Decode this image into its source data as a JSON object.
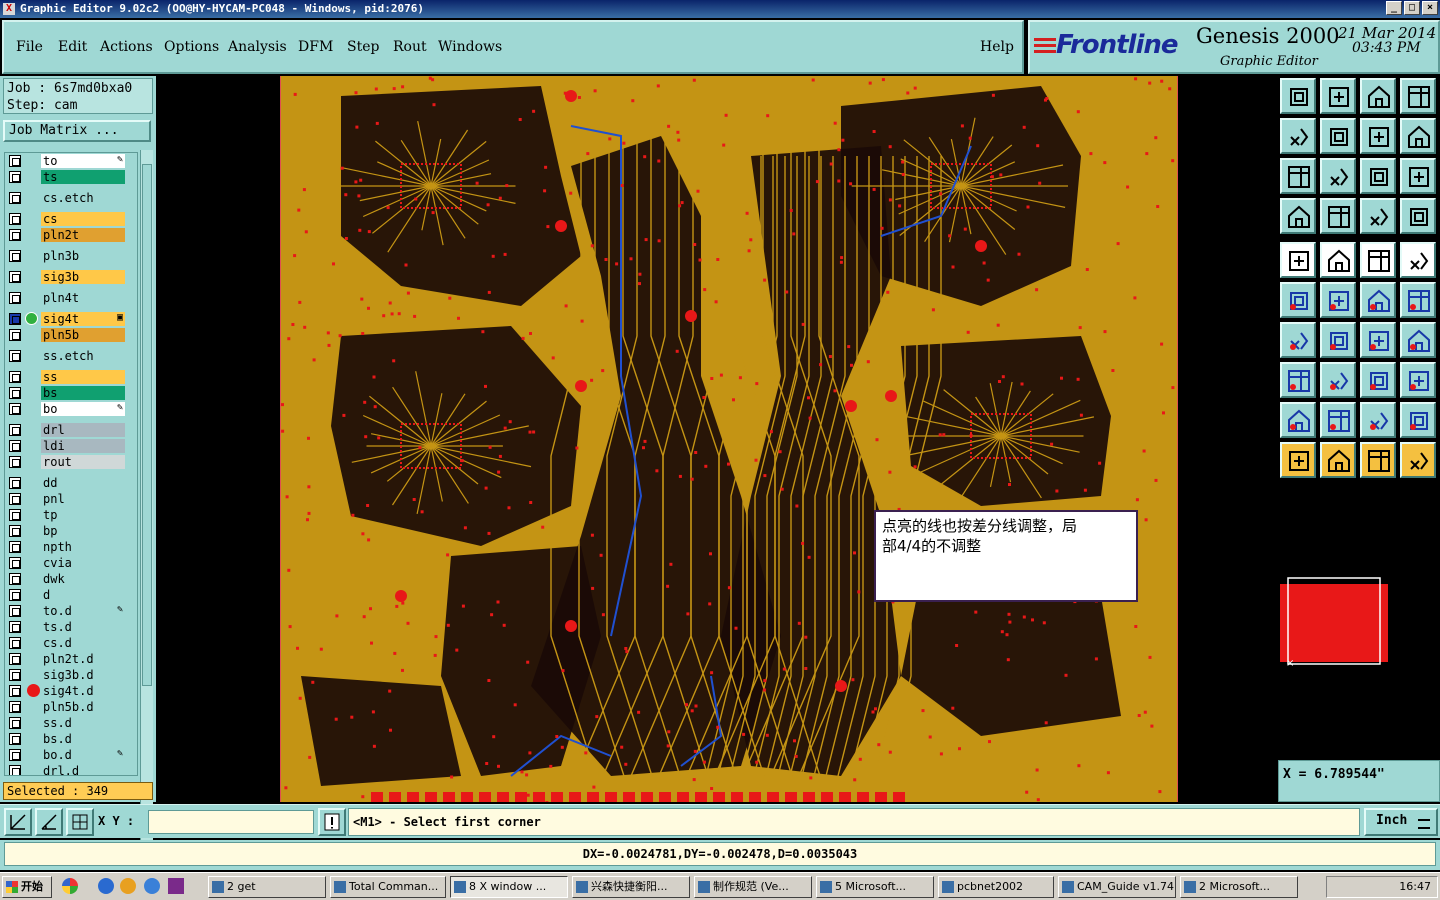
{
  "window": {
    "title": "Graphic Editor 9.02c2 (OO@HY-HYCAM-PC048 - Windows, pid:2076)",
    "buttons": [
      "_",
      "□",
      "×"
    ]
  },
  "menu": {
    "items": [
      "File",
      "Edit",
      "Actions",
      "Options",
      "Analysis",
      "DFM",
      "Step",
      "Rout",
      "Windows"
    ],
    "help": "Help"
  },
  "brand": {
    "logo": "Frontline",
    "product": "Genesis 2000",
    "subtitle": "Graphic Editor",
    "date": "21 Mar 2014",
    "time": "03:43 PM"
  },
  "job": {
    "job_line": "Job  : 6s7md0bxa0",
    "step_line": "Step: cam",
    "matrix_button": "Job Matrix ..."
  },
  "layers": [
    {
      "name": "to",
      "color": "#ffffff",
      "mark": "✎"
    },
    {
      "name": "ts",
      "color": "#10a070",
      "mark": ""
    },
    {
      "name": "cs.etch",
      "color": "#9fd8d4",
      "mark": ""
    },
    {
      "name": "cs",
      "color": "#ffc848",
      "mark": ""
    },
    {
      "name": "pln2t",
      "color": "#e0a030",
      "mark": ""
    },
    {
      "name": "pln3b",
      "color": "#9fd8d4",
      "mark": ""
    },
    {
      "name": "sig3b",
      "color": "#ffc848",
      "mark": ""
    },
    {
      "name": "pln4t",
      "color": "#9fd8d4",
      "mark": ""
    },
    {
      "name": "sig4t",
      "color": "#ffc848",
      "mark": "▣",
      "active": true
    },
    {
      "name": "pln5b",
      "color": "#e0a030",
      "mark": ""
    },
    {
      "name": "ss.etch",
      "color": "#9fd8d4",
      "mark": ""
    },
    {
      "name": "ss",
      "color": "#ffc848",
      "mark": ""
    },
    {
      "name": "bs",
      "color": "#10a070",
      "mark": ""
    },
    {
      "name": "bo",
      "color": "#ffffff",
      "mark": "✎"
    },
    {
      "name": "drl",
      "color": "#a8b8c0",
      "mark": ""
    },
    {
      "name": "ldi",
      "color": "#a8b8c0",
      "mark": ""
    },
    {
      "name": "rout",
      "color": "#d0d8d8",
      "mark": ""
    },
    {
      "name": "dd",
      "color": "#9fd8d4",
      "mark": ""
    },
    {
      "name": "pnl",
      "color": "#9fd8d4",
      "mark": ""
    },
    {
      "name": "tp",
      "color": "#9fd8d4",
      "mark": ""
    },
    {
      "name": "bp",
      "color": "#9fd8d4",
      "mark": ""
    },
    {
      "name": "npth",
      "color": "#9fd8d4",
      "mark": ""
    },
    {
      "name": "cvia",
      "color": "#9fd8d4",
      "mark": ""
    },
    {
      "name": "dwk",
      "color": "#9fd8d4",
      "mark": ""
    },
    {
      "name": "d",
      "color": "#9fd8d4",
      "mark": ""
    },
    {
      "name": "to.d",
      "color": "#9fd8d4",
      "mark": "✎"
    },
    {
      "name": "ts.d",
      "color": "#9fd8d4",
      "mark": ""
    },
    {
      "name": "cs.d",
      "color": "#9fd8d4",
      "mark": ""
    },
    {
      "name": "pln2t.d",
      "color": "#9fd8d4",
      "mark": ""
    },
    {
      "name": "sig3b.d",
      "color": "#9fd8d4",
      "mark": ""
    },
    {
      "name": "sig4t.d",
      "color": "#9fd8d4",
      "mark": "",
      "dot": true
    },
    {
      "name": "pln5b.d",
      "color": "#9fd8d4",
      "mark": ""
    },
    {
      "name": "ss.d",
      "color": "#9fd8d4",
      "mark": ""
    },
    {
      "name": "bs.d",
      "color": "#9fd8d4",
      "mark": ""
    },
    {
      "name": "bo.d",
      "color": "#9fd8d4",
      "mark": "✎"
    },
    {
      "name": "drl.d",
      "color": "#9fd8d4",
      "mark": ""
    }
  ],
  "selected": "Selected : 349",
  "callout": {
    "line1": "点亮的线也按差分线调整，局",
    "line2": "部4/4的不调整"
  },
  "toolbar_icons": [
    "zoom-home-icon",
    "zoom-back-icon",
    "home-icon",
    "window-icon",
    "pan-left-icon",
    "pan-right-icon",
    "swap-icon",
    "snap-icon",
    "fit-icon",
    "center-icon",
    "ratio-icon",
    "help-icon",
    "ruler-icon",
    "grid-icon",
    "layer-feature-icon",
    "layer-feature-alt-icon",
    "pad-icon",
    "line-icon",
    "measure-icon",
    "circle-icon",
    "net-icon",
    "cross-icon",
    "connect-icon",
    "snap-point-icon",
    "angle-icon",
    "slant-icon",
    "arc-icon",
    "mirror-icon",
    "edit-node-icon",
    "bar-icon",
    "dimension-icon",
    "attrib-icon",
    "triangle-icon",
    "triangle-alt-icon",
    "arch-icon",
    "arch-alt-icon",
    "pointer-icon",
    "select-icon",
    "select-region-icon",
    "select-net-icon"
  ],
  "accent": {
    "board": "#c49414",
    "copper_dark": "#1a0a06",
    "pad": "#e81818",
    "trace_highlight": "#2050d0"
  },
  "x_readout": "X = 6.789544\"",
  "command": {
    "xy_label": "X Y :",
    "xy_value": "",
    "prompt": "<M1> - Select first corner",
    "units": "Inch"
  },
  "measure": "DX=-0.0024781,DY=-0.002478,D=0.0035043",
  "taskbar": {
    "start": "开始",
    "tasks": [
      {
        "label": "2 get",
        "active": false
      },
      {
        "label": "Total Comman...",
        "active": false
      },
      {
        "label": "8 X window ...",
        "active": true
      },
      {
        "label": "兴森快捷衡阳...",
        "active": false
      },
      {
        "label": "制作规范 (Ve...",
        "active": false
      },
      {
        "label": "5 Microsoft...",
        "active": false
      },
      {
        "label": "pcbnet2002",
        "active": false
      },
      {
        "label": "CAM_Guide v1.74",
        "active": false
      },
      {
        "label": "2 Microsoft...",
        "active": false
      }
    ],
    "clock": "16:47"
  }
}
